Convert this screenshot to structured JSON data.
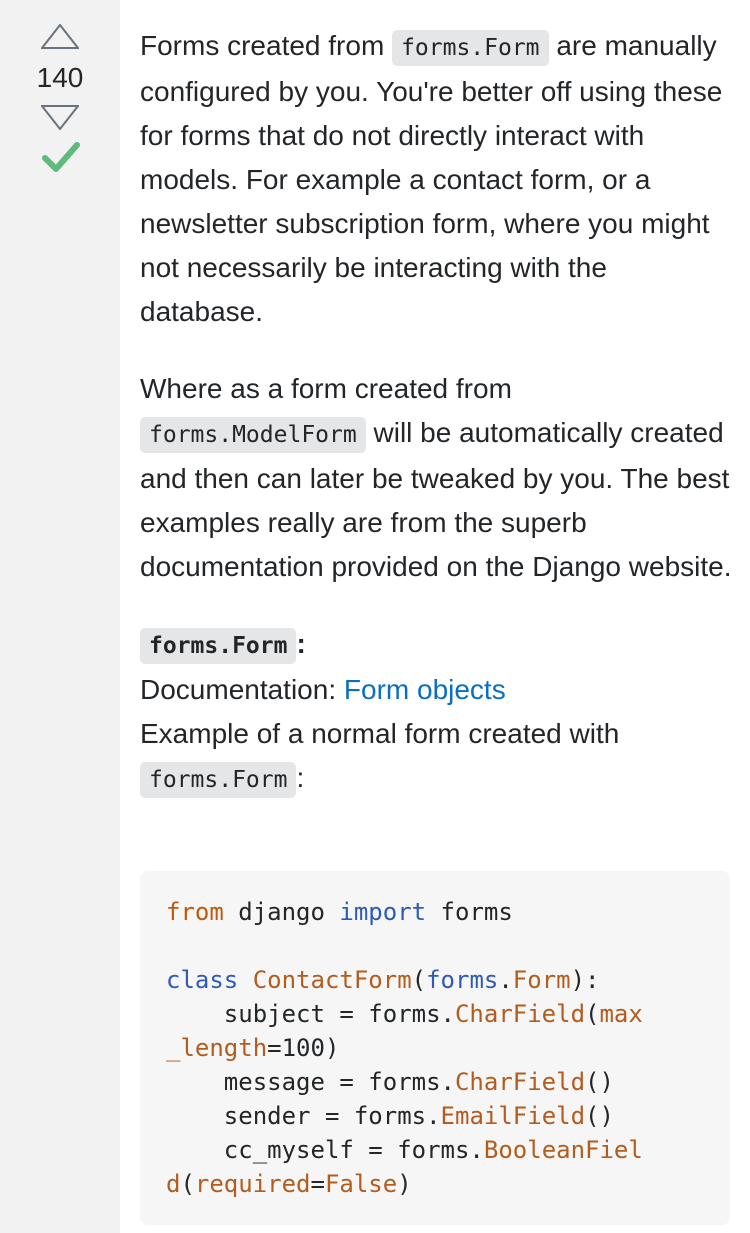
{
  "vote": {
    "count": "140",
    "up_icon": "arrow-up-outline-icon",
    "down_icon": "arrow-down-outline-icon",
    "accepted_icon": "checkmark-icon",
    "accepted_color": "#5eba7d"
  },
  "answer": {
    "p1": {
      "t1": "Forms created from ",
      "code1": "forms.Form",
      "t2": " are manually configured by you. You're better off using these for forms that do not directly interact with models. For example a contact form, or a newsletter subscription form, where you might not necessarily be interacting with the database."
    },
    "p2": {
      "t1": "Where as a form created from ",
      "code1": "forms.ModelForm",
      "t2": " will be automatically created and then can later be tweaked by you. The best examples really are from the superb documentation provided on the Django website."
    },
    "p3": {
      "heading_code": "forms.Form",
      "heading_colon": ":",
      "doc_label": "Documentation: ",
      "doc_link": "Form objects",
      "example_text": "Example of a normal form created with ",
      "example_code": "forms.Form",
      "example_colon": ":"
    },
    "code": {
      "l1_from": "from",
      "l1_mod": " django ",
      "l1_import": "import",
      "l1_rest": " forms",
      "l3_class": "class",
      "l3_name": " ContactForm",
      "l3_paren": "(",
      "l3_base_mod": "forms",
      "l3_dot": ".",
      "l3_base": "Form",
      "l3_end": "):",
      "l4_pre": "    subject = forms.",
      "l4_fn": "CharField",
      "l4_paren": "(",
      "l4_kw": "max",
      "l5_kw": "_length",
      "l5_rest": "=100)",
      "l6_pre": "    message = forms.",
      "l6_fn": "CharField",
      "l6_rest": "()",
      "l7_pre": "    sender = forms.",
      "l7_fn": "EmailField",
      "l7_rest": "()",
      "l8_pre": "    cc_myself = forms.",
      "l8_fn": "BooleanFiel",
      "l9_fn": "d",
      "l9_paren": "(",
      "l9_kw": "required",
      "l9_eq": "=",
      "l9_val": "False",
      "l9_end": ")"
    }
  }
}
